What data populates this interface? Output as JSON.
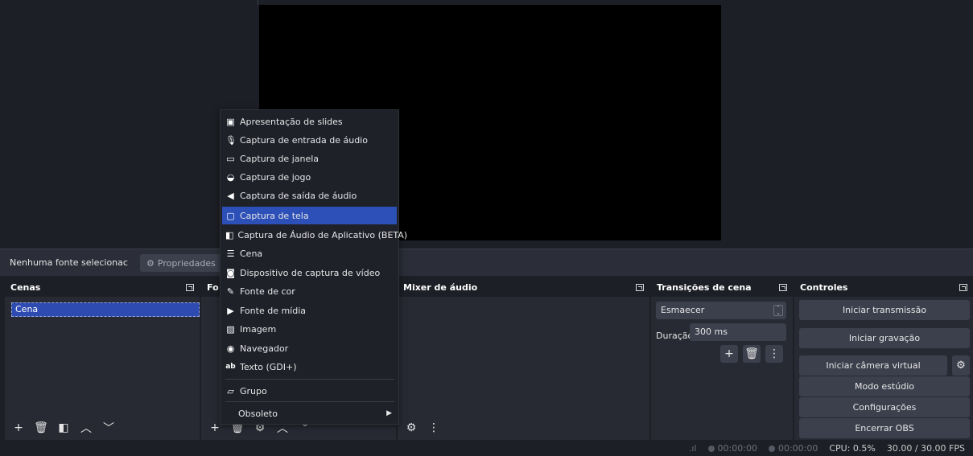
{
  "context_bar": {
    "no_source": "Nenhuma fonte selecionac",
    "properties": "Propriedades"
  },
  "scenes": {
    "title": "Cenas",
    "items": [
      "Cena"
    ]
  },
  "sources": {
    "title": "Fo"
  },
  "mixer": {
    "title": "Mixer de áudio"
  },
  "transitions": {
    "title": "Transições de cena",
    "selected": "Esmaecer",
    "duration_label": "Duração",
    "duration_value": "300 ms"
  },
  "controls": {
    "title": "Controles",
    "start_stream": "Iniciar transmissão",
    "start_record": "Iniciar gravação",
    "start_virtual_cam": "Iniciar câmera virtual",
    "studio_mode": "Modo estúdio",
    "settings": "Configurações",
    "exit": "Encerrar OBS"
  },
  "status": {
    "stream_time": "00:00:00",
    "rec_time": "00:00:00",
    "cpu": "CPU: 0.5%",
    "fps": "30.00 / 30.00 FPS"
  },
  "menu": {
    "items": [
      {
        "label": "Apresentação de slides",
        "icon": "slideshow-icon"
      },
      {
        "label": "Captura de entrada de áudio",
        "icon": "microphone-icon"
      },
      {
        "label": "Captura de janela",
        "icon": "window-icon"
      },
      {
        "label": "Captura de jogo",
        "icon": "gamepad-icon"
      },
      {
        "label": "Captura de saída de áudio",
        "icon": "speaker-icon"
      },
      {
        "label": "Captura de tela",
        "icon": "monitor-icon"
      },
      {
        "label": "Captura de Áudio de Aplicativo (BETA)",
        "icon": "app-audio-icon"
      },
      {
        "label": "Cena",
        "icon": "list-icon"
      },
      {
        "label": "Dispositivo de captura de vídeo",
        "icon": "camera-icon"
      },
      {
        "label": "Fonte de cor",
        "icon": "brush-icon"
      },
      {
        "label": "Fonte de mídia",
        "icon": "play-icon"
      },
      {
        "label": "Imagem",
        "icon": "image-icon"
      },
      {
        "label": "Navegador",
        "icon": "globe-icon"
      },
      {
        "label": "Texto (GDI+)",
        "icon": "text-icon"
      },
      {
        "label": "Grupo",
        "icon": "folder-icon"
      },
      {
        "label": "Obsoleto",
        "icon": ""
      }
    ],
    "selected_index": 5
  },
  "colors": {
    "accent": "#2c50b8",
    "panel": "#272a33",
    "background": "#1d1f26"
  }
}
